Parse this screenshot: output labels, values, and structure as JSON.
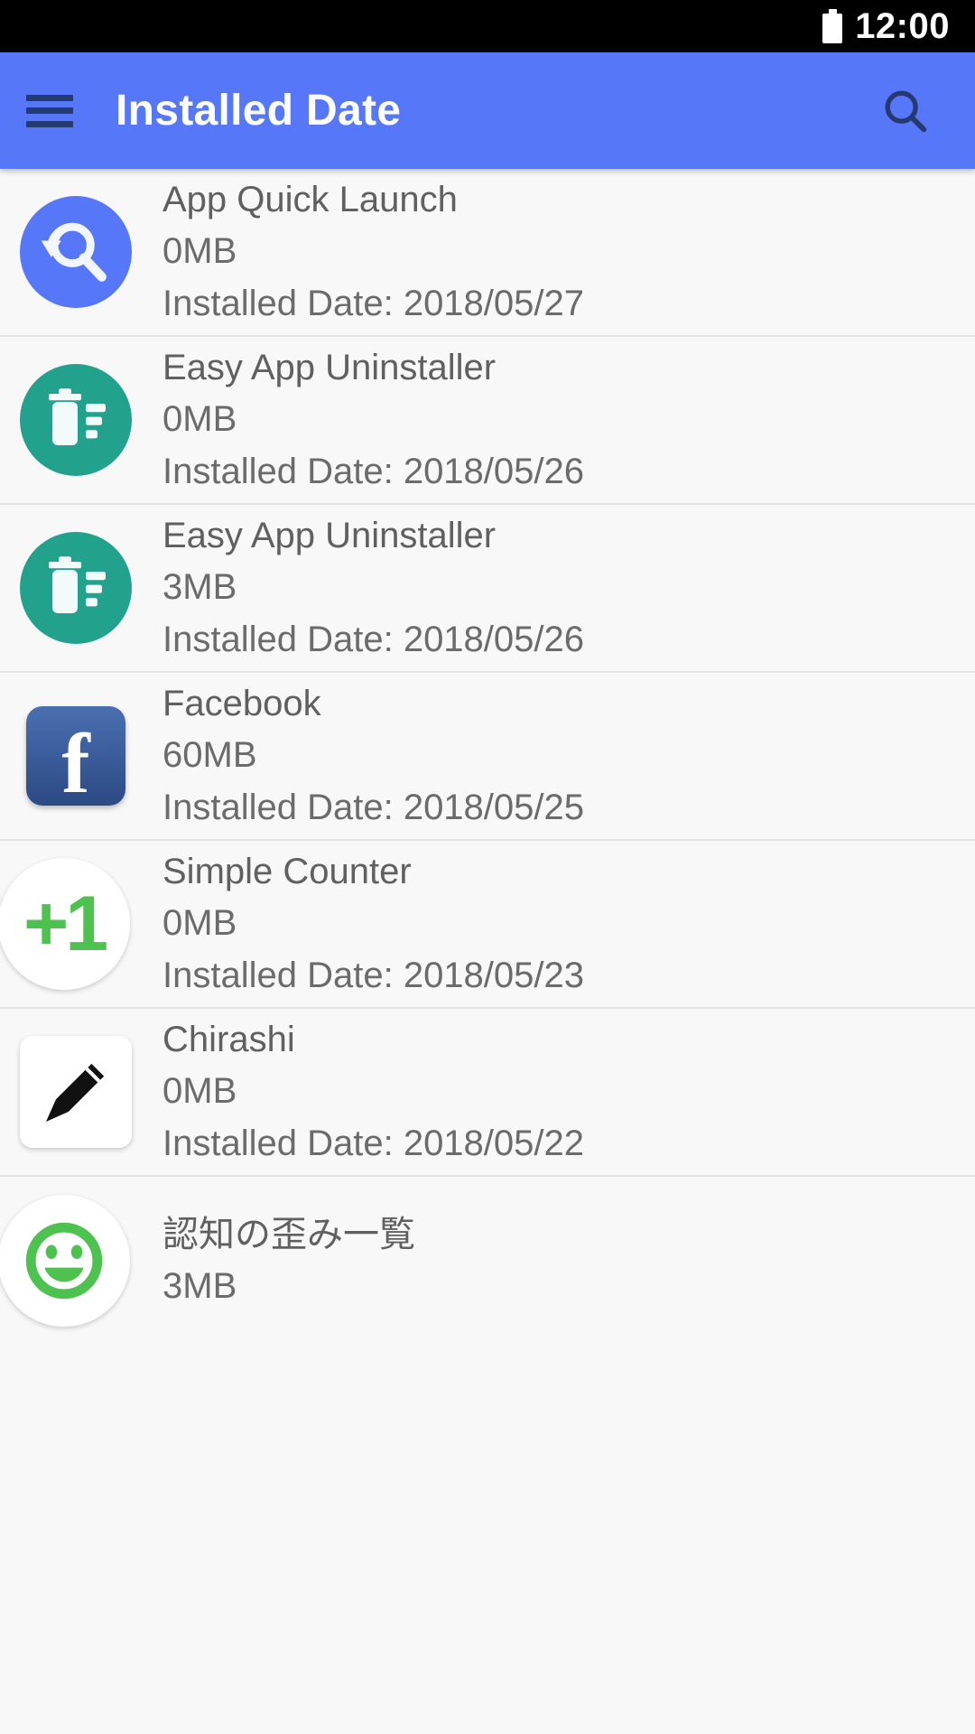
{
  "status_bar": {
    "time": "12:00",
    "battery_icon": "battery-full-icon"
  },
  "app_bar": {
    "title": "Installed Date",
    "menu_icon": "hamburger-menu-icon",
    "search_icon": "search-icon",
    "background_color": "#5577f8",
    "title_color": "#ffffff",
    "icon_color": "#253a6e"
  },
  "list": {
    "date_label_prefix": "Installed Date: ",
    "items": [
      {
        "name": "App Quick Launch",
        "size": "0MB",
        "date_line": "Installed Date: 2018/05/27",
        "date": "2018/05/27",
        "icon": "app-quick-launch-icon",
        "icon_color": "#5577f8"
      },
      {
        "name": "Easy App Uninstaller",
        "size": "0MB",
        "date_line": "Installed Date: 2018/05/26",
        "date": "2018/05/26",
        "icon": "easy-app-uninstaller-icon",
        "icon_color": "#22a18c"
      },
      {
        "name": "Easy App Uninstaller",
        "size": "3MB",
        "date_line": "Installed Date: 2018/05/26",
        "date": "2018/05/26",
        "icon": "easy-app-uninstaller-icon",
        "icon_color": "#22a18c"
      },
      {
        "name": "Facebook",
        "size": "60MB",
        "date_line": "Installed Date: 2018/05/25",
        "date": "2018/05/25",
        "icon": "facebook-icon",
        "icon_color": "#3b5998",
        "glyph": "f"
      },
      {
        "name": "Simple Counter",
        "size": "0MB",
        "date_line": "Installed Date: 2018/05/23",
        "date": "2018/05/23",
        "icon": "simple-counter-icon",
        "icon_color": "#4ec24e",
        "glyph": "+1"
      },
      {
        "name": "Chirashi",
        "size": "0MB",
        "date_line": "Installed Date: 2018/05/22",
        "date": "2018/05/22",
        "icon": "pencil-icon",
        "icon_color": "#111111"
      },
      {
        "name": "認知の歪み一覧",
        "size": "3MB",
        "date_line": "",
        "date": "",
        "icon": "smiley-face-icon",
        "icon_color": "#4ec24e"
      }
    ]
  }
}
